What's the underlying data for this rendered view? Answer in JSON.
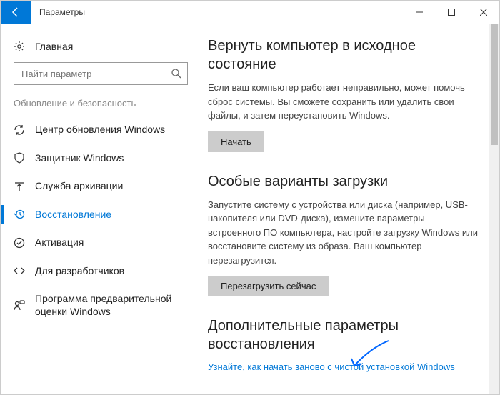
{
  "titlebar": {
    "title": "Параметры"
  },
  "sidebar": {
    "home": "Главная",
    "search_placeholder": "Найти параметр",
    "group": "Обновление и безопасность",
    "items": [
      {
        "label": "Центр обновления Windows"
      },
      {
        "label": "Защитник Windows"
      },
      {
        "label": "Служба архивации"
      },
      {
        "label": "Восстановление"
      },
      {
        "label": "Активация"
      },
      {
        "label": "Для разработчиков"
      },
      {
        "label": "Программа предварительной оценки Windows"
      }
    ]
  },
  "content": {
    "reset": {
      "heading": "Вернуть компьютер в исходное состояние",
      "body": "Если ваш компьютер работает неправильно, может помочь сброс системы. Вы сможете сохранить или удалить свои файлы, и затем переустановить Windows.",
      "button": "Начать"
    },
    "advanced_startup": {
      "heading": "Особые варианты загрузки",
      "body": "Запустите систему с устройства или диска (например, USB-накопителя или DVD-диска), измените параметры встроенного ПО компьютера, настройте загрузку Windows или восстановите систему из образа. Ваш компьютер перезагрузится.",
      "button": "Перезагрузить сейчас"
    },
    "more": {
      "heading": "Дополнительные параметры восстановления",
      "link": "Узнайте, как начать заново с чистой установкой Windows"
    }
  }
}
